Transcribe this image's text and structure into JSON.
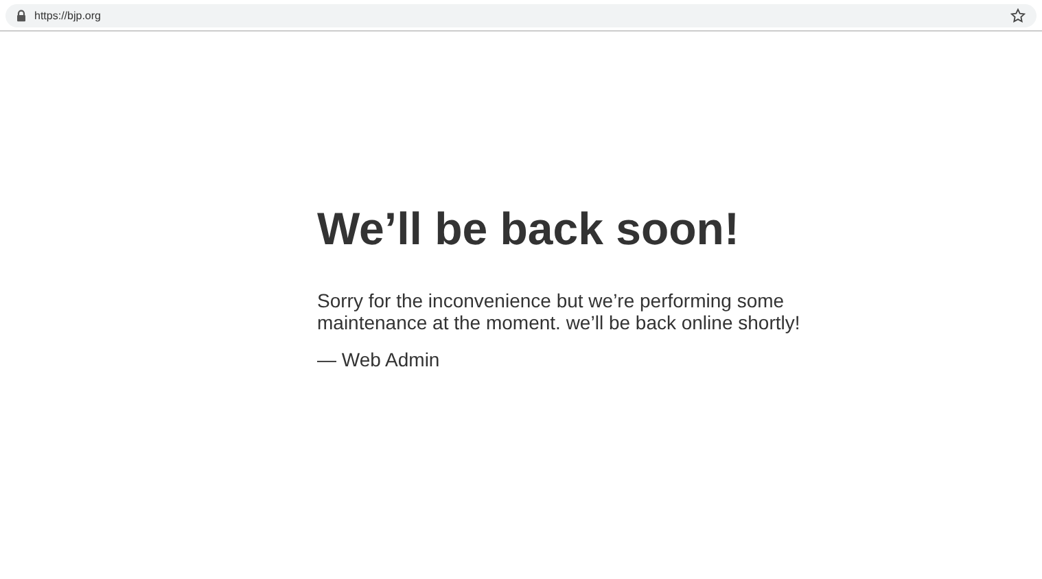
{
  "browser": {
    "url": "https://bjp.org"
  },
  "page": {
    "heading": "We’ll be back soon!",
    "message": "Sorry for the inconvenience but we’re performing some maintenance at the moment. we’ll be back online shortly!",
    "signature": "— Web Admin"
  }
}
